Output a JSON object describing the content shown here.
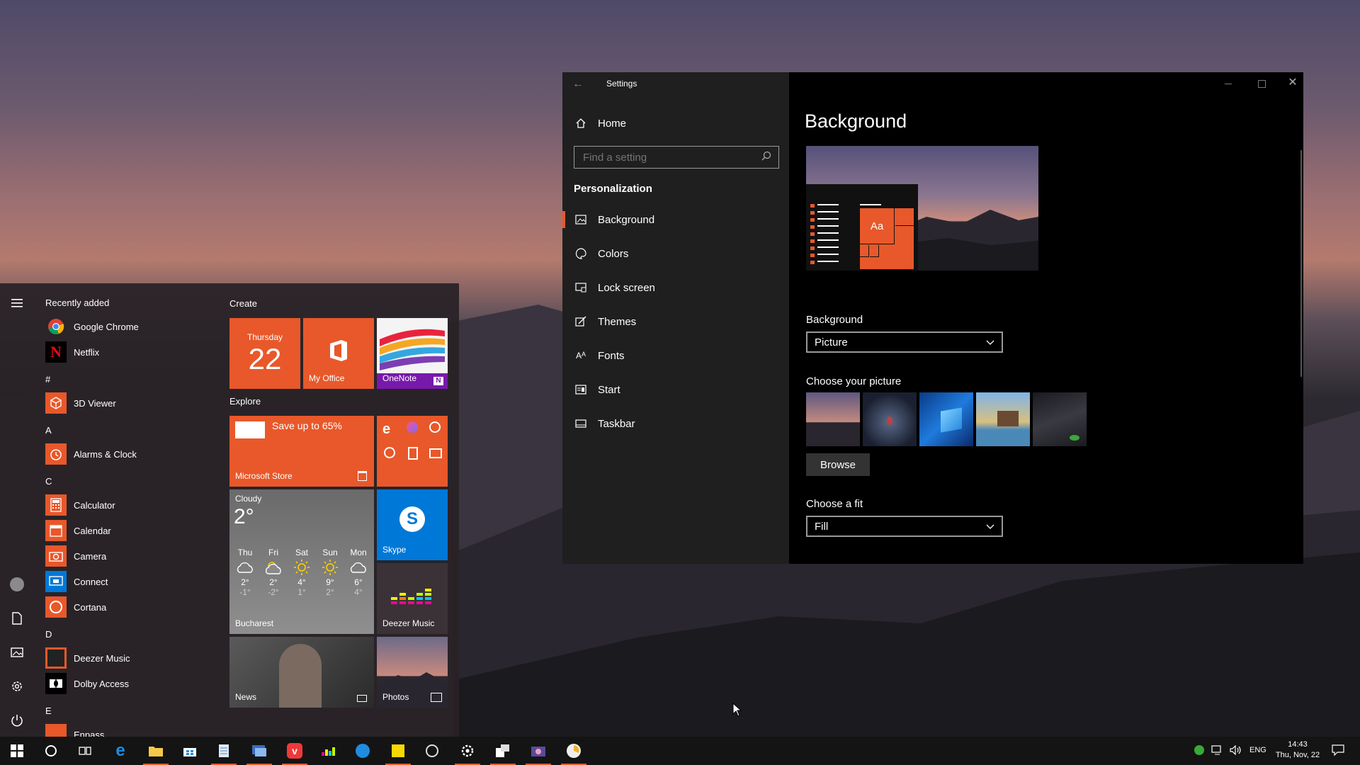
{
  "start_menu": {
    "recently_added": "Recently added",
    "apps_recent": [
      {
        "name": "Google Chrome"
      },
      {
        "name": "Netflix"
      }
    ],
    "sections": [
      {
        "letter": "#",
        "apps": [
          "3D Viewer"
        ]
      },
      {
        "letter": "A",
        "apps": [
          "Alarms & Clock"
        ]
      },
      {
        "letter": "C",
        "apps": [
          "Calculator",
          "Calendar",
          "Camera",
          "Connect",
          "Cortana"
        ]
      },
      {
        "letter": "D",
        "apps": [
          "Deezer Music",
          "Dolby Access"
        ]
      },
      {
        "letter": "E",
        "apps": [
          "Enpass"
        ]
      }
    ],
    "groups": {
      "create": "Create",
      "explore": "Explore"
    },
    "tiles": {
      "calendar": {
        "day": "Thursday",
        "date": "22"
      },
      "office": "My Office",
      "onenote": "OneNote",
      "store": {
        "promo": "Save up to 65%",
        "label": "Microsoft Store"
      },
      "weather": {
        "condition": "Cloudy",
        "temp": "2°",
        "city": "Bucharest",
        "days": [
          {
            "d": "Thu",
            "icon": "cloud",
            "hi": "2°",
            "lo": "-1°"
          },
          {
            "d": "Fri",
            "icon": "sun-cloud",
            "hi": "2°",
            "lo": "-2°"
          },
          {
            "d": "Sat",
            "icon": "sun",
            "hi": "4°",
            "lo": "1°"
          },
          {
            "d": "Sun",
            "icon": "sun",
            "hi": "9°",
            "lo": "2°"
          },
          {
            "d": "Mon",
            "icon": "cloud",
            "hi": "6°",
            "lo": "4°"
          }
        ]
      },
      "skype": "Skype",
      "deezer": "Deezer Music",
      "news": "News",
      "photos": "Photos"
    }
  },
  "settings": {
    "title": "Settings",
    "home": "Home",
    "search_placeholder": "Find a setting",
    "category": "Personalization",
    "nav": [
      {
        "label": "Background",
        "icon": "picture-icon",
        "selected": true
      },
      {
        "label": "Colors",
        "icon": "palette-icon",
        "selected": false
      },
      {
        "label": "Lock screen",
        "icon": "lock-screen-icon",
        "selected": false
      },
      {
        "label": "Themes",
        "icon": "brush-icon",
        "selected": false
      },
      {
        "label": "Fonts",
        "icon": "font-icon",
        "selected": false
      },
      {
        "label": "Start",
        "icon": "start-icon",
        "selected": false
      },
      {
        "label": "Taskbar",
        "icon": "taskbar-icon",
        "selected": false
      }
    ],
    "page_title": "Background",
    "preview_tile_text": "Aa",
    "background_label": "Background",
    "background_value": "Picture",
    "choose_picture_label": "Choose your picture",
    "browse_label": "Browse",
    "fit_label": "Choose a fit",
    "fit_value": "Fill"
  },
  "taskbar": {
    "lang": "ENG",
    "time": "14:43",
    "date": "Thu, Nov, 22"
  },
  "colors": {
    "accent": "#e8582a"
  }
}
